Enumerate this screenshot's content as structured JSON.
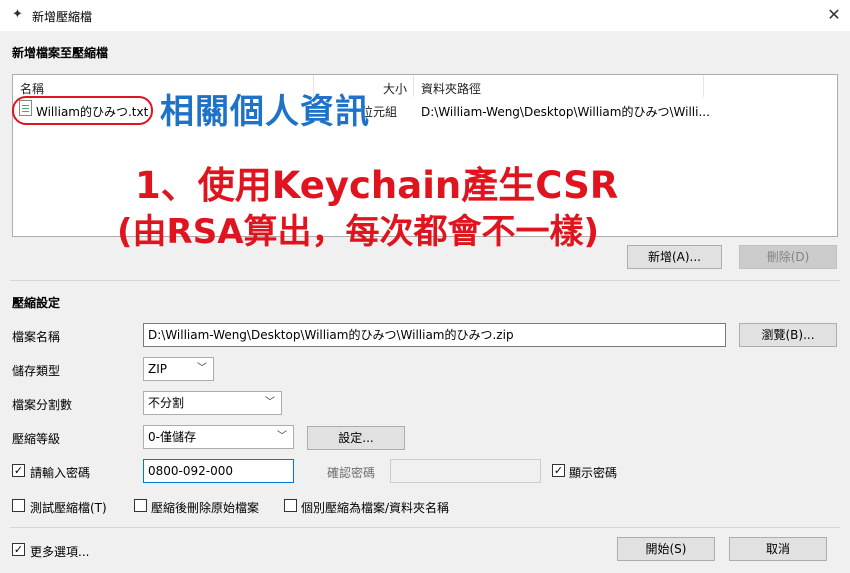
{
  "window": {
    "title": "新增壓縮檔",
    "icon": "pin-icon"
  },
  "add_files": {
    "heading": "新增檔案至壓縮檔",
    "columns": [
      "名稱",
      "大小",
      "資料夾路徑"
    ],
    "file": {
      "name": "William的ひみつ.txt",
      "size": "位元組",
      "path": "D:\\William-Weng\\Desktop\\William的ひみつ\\Willi..."
    },
    "add_button": "新增(A)...",
    "delete_button": "刪除(D)"
  },
  "annotations": {
    "blue": "相關個人資訊",
    "red_line1": "1、使用Keychain產生CSR",
    "red_line2": "(由RSA算出，每次都會不一樣)"
  },
  "compress": {
    "heading": "壓縮設定",
    "filename_label": "檔案名稱",
    "filename_value": "D:\\William-Weng\\Desktop\\William的ひみつ\\William的ひみつ.zip",
    "browse_button": "瀏覽(B)...",
    "type_label": "儲存類型",
    "type_value": "ZIP",
    "split_label": "檔案分割數",
    "split_value": "不分割",
    "level_label": "壓縮等級",
    "level_value": "0-僅儲存",
    "settings_button": "設定...",
    "password_label": "請輸入密碼",
    "password_checked": true,
    "password_value": "0800-092-000",
    "confirm_label": "確認密碼",
    "show_password_label": "顯示密碼",
    "show_password_checked": true,
    "test_label": "測試壓縮檔(T)",
    "delete_original_label": "壓縮後刪除原始檔案",
    "separate_label": "個別壓縮為檔案/資料夾名稱"
  },
  "footer": {
    "more_options_label": "更多選項...",
    "more_options_checked": true,
    "start_button": "開始(S)",
    "cancel_button": "取消"
  },
  "check_mark": "✓"
}
